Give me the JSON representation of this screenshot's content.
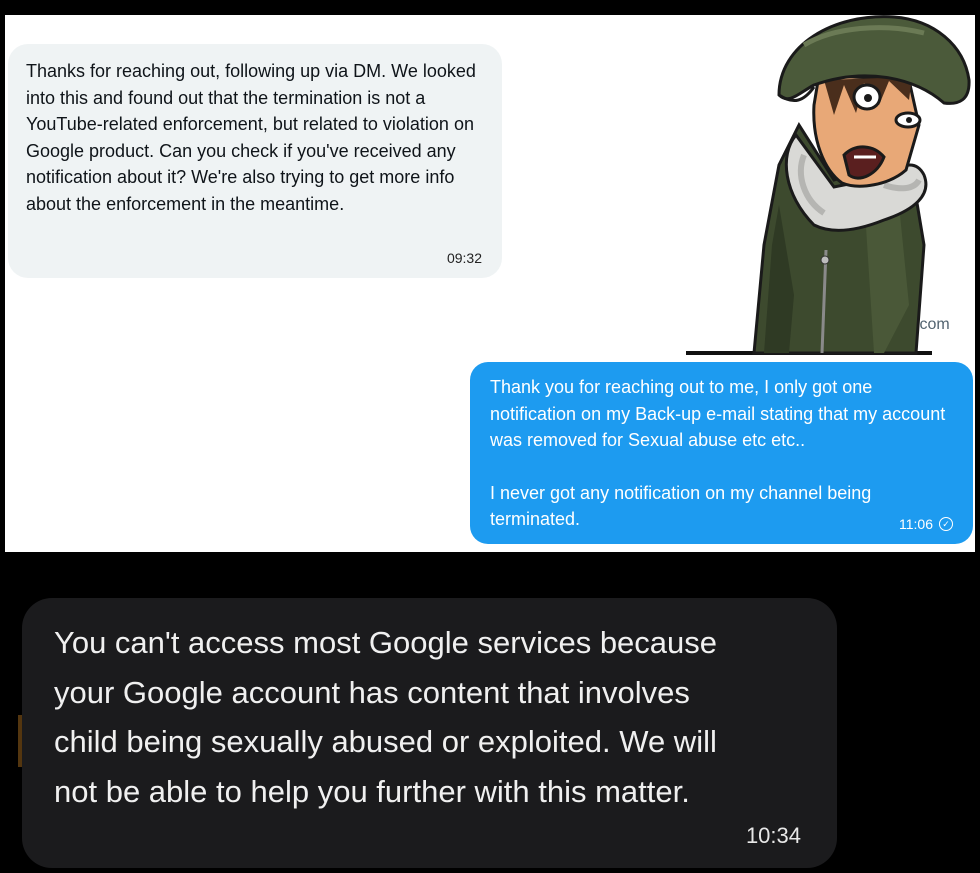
{
  "incoming_message": {
    "text": "Thanks for reaching out, following up via DM. We looked into this and found out that the termination is not a YouTube-related enforcement, but related to violation on Google product. Can you check if you've received any notification about it? We're also trying to get more info about the enforcement in the meantime.",
    "time": "09:32"
  },
  "partial_url_text": ".com",
  "outgoing_message": {
    "paragraph_1": "Thank you for reaching out to me, I only got one notification on my Back-up e-mail stating that my account was removed for Sexual abuse etc etc..",
    "paragraph_2": "I never got any notification on my channel being terminated.",
    "time": "11:06",
    "status_icon": "sent-check-icon"
  },
  "dark_message": {
    "line_1": "You can't access most Google services because",
    "line_2": "your Google account has content that involves",
    "line_3": "child being sexually abused or exploited. We will",
    "line_4": "not be able to help you further with this matter.",
    "time": "10:34"
  },
  "colors": {
    "incoming_bubble": "#eff3f4",
    "outgoing_bubble": "#1d9bf0",
    "dark_bubble": "#1b1b1d",
    "highlight": "#8c5a19"
  }
}
